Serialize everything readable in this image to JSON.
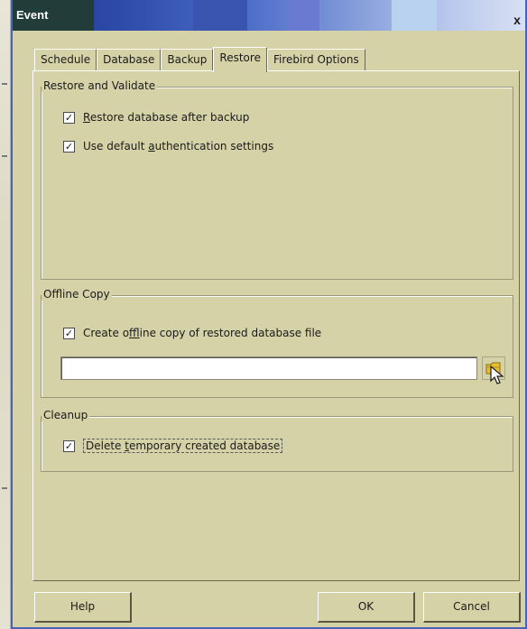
{
  "window": {
    "title": "Event",
    "close_glyph": "x"
  },
  "tabs": [
    {
      "label": "Schedule",
      "active": false
    },
    {
      "label": "Database",
      "active": false
    },
    {
      "label": "Backup",
      "active": false
    },
    {
      "label": "Restore",
      "active": true
    },
    {
      "label": "Firebird Options",
      "active": false
    }
  ],
  "restore_validate": {
    "title": "Restore and Validate",
    "restore_after_backup": {
      "label_pre": "",
      "label_accel": "R",
      "label_post": "estore database after backup",
      "checked": true
    },
    "default_auth": {
      "label_pre": "Use default ",
      "label_accel": "a",
      "label_post": "uthentication settings",
      "checked": true
    }
  },
  "offline_copy": {
    "title": "Offline Copy",
    "create_copy": {
      "label_pre": "Create o",
      "label_accel": "f",
      "label_post": "fline copy of restored database file",
      "checked": true
    },
    "path_value": "",
    "browse_icon": "folder-icon"
  },
  "cleanup": {
    "title": "Cleanup",
    "delete_temp": {
      "label_pre": "Delete ",
      "label_accel": "t",
      "label_post": "emporary created database",
      "checked": true
    }
  },
  "buttons": {
    "help": "Help",
    "ok": "OK",
    "cancel": "Cancel"
  },
  "colors": {
    "dialog_bg": "#d6d2a8",
    "titlebar_start": "#1f3a8c",
    "titlebar_end": "#d8e0f4",
    "folder": "#e8c030"
  }
}
